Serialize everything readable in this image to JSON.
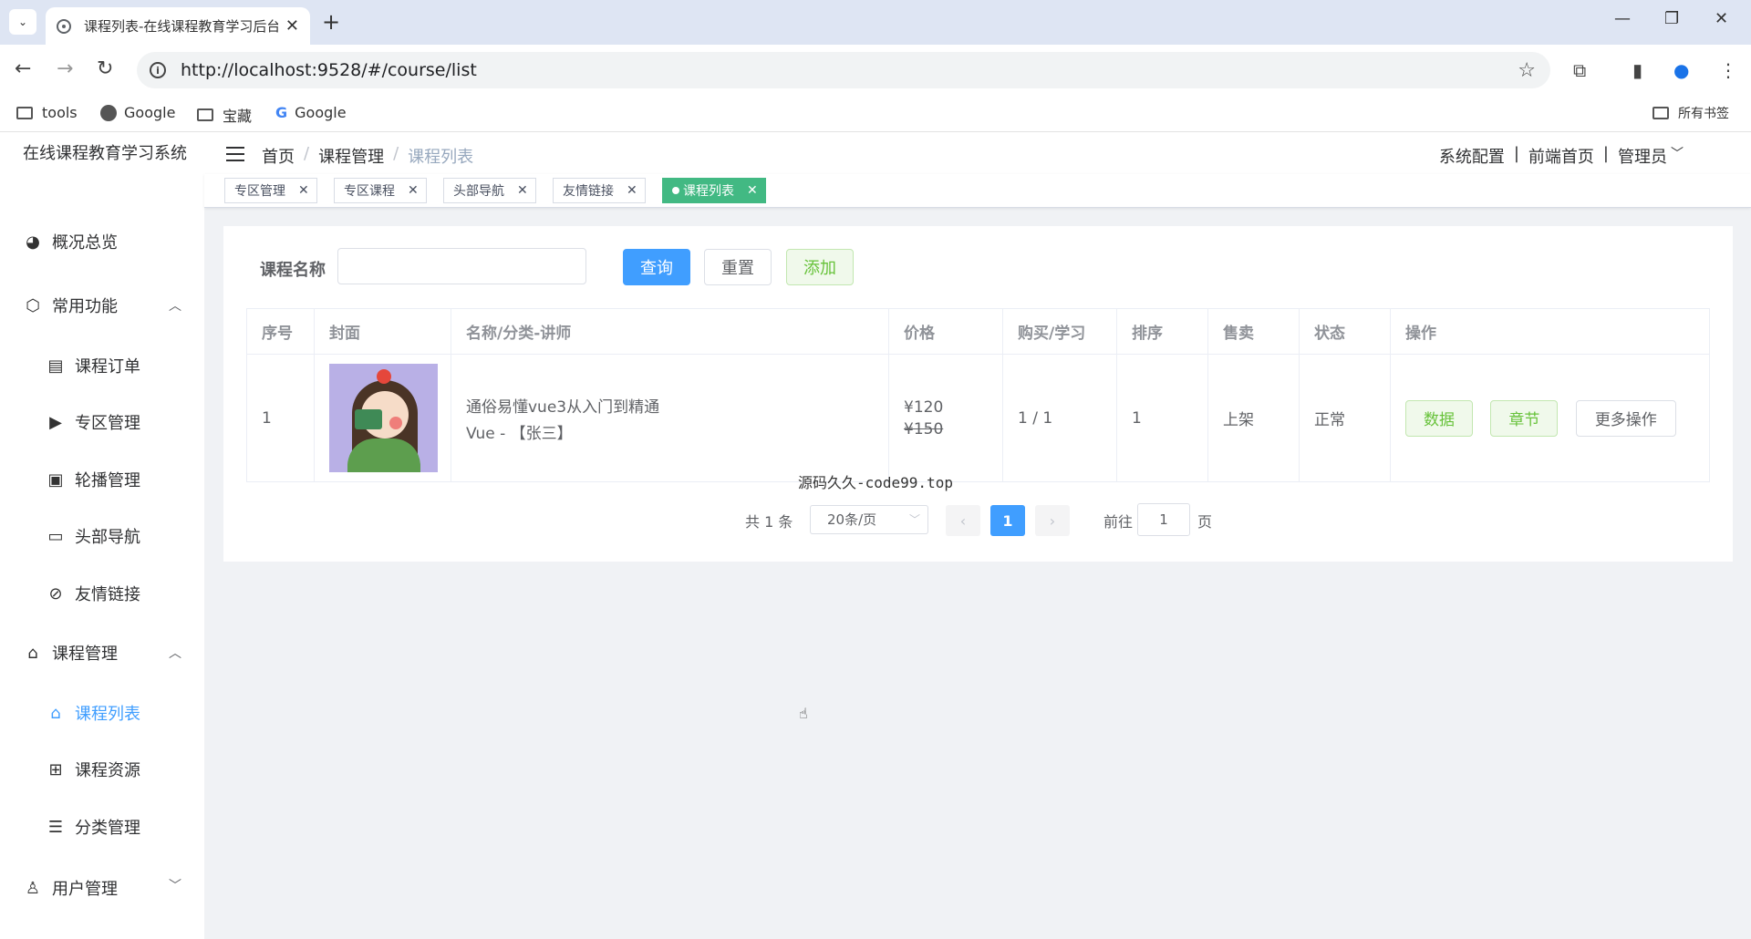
{
  "browser": {
    "tab_title": "课程列表-在线课程教育学习后台",
    "url": "http://localhost:9528/#/course/list",
    "bookmarks": [
      "tools",
      "Google",
      "宝藏",
      "Google"
    ],
    "all_bookmarks": "所有书签"
  },
  "sidebar": {
    "logo": "在线课程教育学习系统",
    "items": [
      {
        "label": "概况总览",
        "icon": "dashboard-icon"
      },
      {
        "label": "常用功能",
        "icon": "cube-icon"
      },
      {
        "label": "课程订单",
        "icon": "document-icon"
      },
      {
        "label": "专区管理",
        "icon": "play-box-icon"
      },
      {
        "label": "轮播管理",
        "icon": "picture-icon"
      },
      {
        "label": "头部导航",
        "icon": "window-icon"
      },
      {
        "label": "友情链接",
        "icon": "link-icon"
      },
      {
        "label": "课程管理",
        "icon": "graduation-icon"
      },
      {
        "label": "课程列表",
        "icon": "graduation-icon"
      },
      {
        "label": "课程资源",
        "icon": "grid-icon"
      },
      {
        "label": "分类管理",
        "icon": "list-icon"
      },
      {
        "label": "用户管理",
        "icon": "users-icon"
      }
    ]
  },
  "breadcrumb": [
    "首页",
    "课程管理",
    "课程列表"
  ],
  "header_links": [
    "系统配置",
    "前端首页",
    "管理员"
  ],
  "tags": [
    "专区管理",
    "专区课程",
    "头部导航",
    "友情链接",
    "课程列表"
  ],
  "search": {
    "label": "课程名称",
    "value": "",
    "query_btn": "查询",
    "reset_btn": "重置",
    "add_btn": "添加"
  },
  "table": {
    "headers": [
      "序号",
      "封面",
      "名称/分类-讲师",
      "价格",
      "购买/学习",
      "排序",
      "售卖",
      "状态",
      "操作"
    ],
    "rows": [
      {
        "index": "1",
        "name": "通俗易懂vue3从入门到精通",
        "category": "Vue - 【张三】",
        "price": "¥120",
        "original_price": "¥150",
        "buy_learn": "1 / 1",
        "sort": "1",
        "sale": "上架",
        "status": "正常",
        "ops": [
          "数据",
          "章节",
          "更多操作"
        ]
      }
    ]
  },
  "note": "源码久久-code99.top",
  "pagination": {
    "total": "共 1 条",
    "size": "20条/页",
    "current": "1",
    "goto_label": "前往",
    "goto_value": "1",
    "unit": "页"
  }
}
